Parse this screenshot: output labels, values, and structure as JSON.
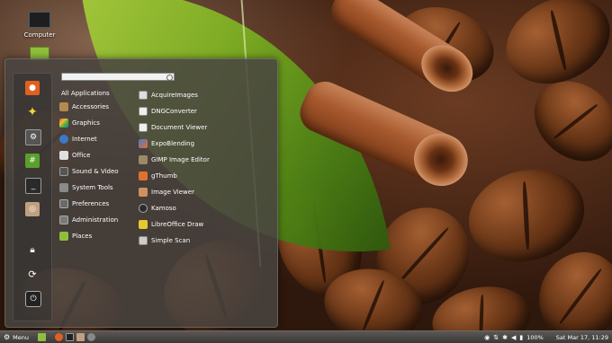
{
  "desktop": {
    "icons": [
      {
        "label": "Computer",
        "icon": "computer-icon"
      },
      {
        "label": "",
        "icon": "home-folder-icon"
      }
    ]
  },
  "menu": {
    "search": {
      "value": "",
      "placeholder": ""
    },
    "favorites": [
      {
        "icon": "firefox-icon",
        "color": "#e06020"
      },
      {
        "icon": "star-icon",
        "color": "#f5d23c"
      },
      {
        "icon": "settings-icon",
        "color": "#7a7a7a"
      },
      {
        "icon": "terminal-green-icon",
        "color": "#5aa02c"
      },
      {
        "icon": "terminal-icon",
        "color": "#2a2a2a"
      },
      {
        "icon": "files-icon",
        "color": "#c0a080"
      }
    ],
    "session": [
      {
        "icon": "lock-icon"
      },
      {
        "icon": "logout-icon"
      },
      {
        "icon": "power-icon"
      }
    ],
    "categories_header": "All Applications",
    "categories": [
      {
        "label": "Accessories",
        "icon": "accessories-icon",
        "color": "#b58a4c"
      },
      {
        "label": "Graphics",
        "icon": "graphics-icon",
        "color": "#c64aa0"
      },
      {
        "label": "Internet",
        "icon": "internet-icon",
        "color": "#3a78c8"
      },
      {
        "label": "Office",
        "icon": "office-icon",
        "color": "#e0e0e0"
      },
      {
        "label": "Sound & Video",
        "icon": "multimedia-icon",
        "color": "#555555"
      },
      {
        "label": "System Tools",
        "icon": "system-tools-icon",
        "color": "#8a8a8a"
      },
      {
        "label": "Preferences",
        "icon": "preferences-icon",
        "color": "#6a6a6a"
      },
      {
        "label": "Administration",
        "icon": "administration-icon",
        "color": "#7a7a7a"
      },
      {
        "label": "Places",
        "icon": "folder-icon",
        "color": "#8fbe3c"
      }
    ],
    "apps": [
      {
        "label": "AcquireImages",
        "icon": "acquire-icon",
        "color": "#dddddd"
      },
      {
        "label": "DNGConverter",
        "icon": "dng-icon",
        "color": "#eeeeee"
      },
      {
        "label": "Document Viewer",
        "icon": "document-viewer-icon",
        "color": "#f0f0f0"
      },
      {
        "label": "ExpoBlending",
        "icon": "expoblending-icon",
        "color": "#4a7ad0"
      },
      {
        "label": "GIMP Image Editor",
        "icon": "gimp-icon",
        "color": "#9a8a6a"
      },
      {
        "label": "gThumb",
        "icon": "gthumb-icon",
        "color": "#e07030"
      },
      {
        "label": "Image Viewer",
        "icon": "image-viewer-icon",
        "color": "#d09060"
      },
      {
        "label": "Kamoso",
        "icon": "kamoso-icon",
        "color": "#2a2a2a"
      },
      {
        "label": "LibreOffice Draw",
        "icon": "libreoffice-draw-icon",
        "color": "#e8c830"
      },
      {
        "label": "Simple Scan",
        "icon": "scanner-icon",
        "color": "#cccccc"
      }
    ]
  },
  "taskbar": {
    "menu_label": "Menu",
    "launchers": [
      {
        "icon": "show-desktop-icon",
        "color": "#8fbe3c"
      },
      {
        "icon": "firefox-icon",
        "color": "#e06020"
      },
      {
        "icon": "terminal-icon",
        "color": "#222222"
      },
      {
        "icon": "files-icon",
        "color": "#c0a080"
      },
      {
        "icon": "settings-icon",
        "color": "#888888"
      }
    ],
    "battery": "100%",
    "clock": "Sat Mar 17, 11:29"
  }
}
